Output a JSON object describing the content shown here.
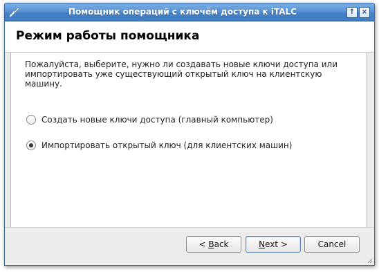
{
  "window": {
    "title": "Помощник операций с ключём доступа к iTALC",
    "up_symbol": "↑",
    "close_symbol": "×"
  },
  "page": {
    "title": "Режим работы помощника",
    "description": "Пожалуйста, выберите, нужно ли создавать новые ключи доступа или импортировать уже существующий открытый ключ на клиентскую машину."
  },
  "options": [
    {
      "label": "Создать новые ключи доступа (главный компьютер)",
      "selected": false
    },
    {
      "label": "Импортировать открытый ключ (для клиентских машин)",
      "selected": true
    }
  ],
  "buttons": {
    "back_prefix": "< ",
    "back_accel": "B",
    "back_rest": "ack",
    "next_accel": "N",
    "next_rest": "ext >",
    "cancel": "Cancel"
  },
  "colors": {
    "titlebar": "#4583c8",
    "accent": "#5b8ac4"
  }
}
